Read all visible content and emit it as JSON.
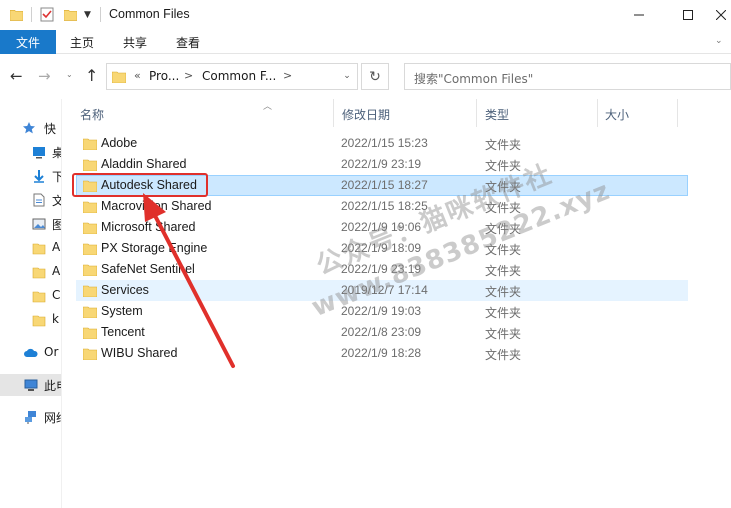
{
  "window": {
    "title": "Common Files"
  },
  "ribbon": {
    "file_tab": "文件",
    "tabs": [
      "主页",
      "共享",
      "查看"
    ]
  },
  "address": {
    "chevrons": "«",
    "crumbs": [
      "Pro...",
      "Common F..."
    ],
    "separator": ">"
  },
  "search": {
    "placeholder": "搜索\"Common Files\""
  },
  "columns": {
    "name": "名称",
    "date": "修改日期",
    "type": "类型",
    "size": "大小"
  },
  "navpane": {
    "items": [
      {
        "label": "快",
        "icon": "star-icon"
      },
      {
        "label": "桌",
        "icon": "desktop-icon"
      },
      {
        "label": "下",
        "icon": "download-icon"
      },
      {
        "label": "文",
        "icon": "document-icon"
      },
      {
        "label": "图",
        "icon": "picture-icon"
      },
      {
        "label": "A",
        "icon": "folder-icon"
      },
      {
        "label": "A",
        "icon": "folder-icon"
      },
      {
        "label": "C",
        "icon": "folder-icon"
      },
      {
        "label": "k",
        "icon": "folder-icon"
      },
      {
        "label": "Or",
        "icon": "cloud-icon"
      },
      {
        "label": "此电",
        "icon": "computer-icon"
      },
      {
        "label": "网络",
        "icon": "network-icon"
      }
    ]
  },
  "files": [
    {
      "name": "Adobe",
      "date": "2022/1/15 15:23",
      "type": "文件夹"
    },
    {
      "name": "Aladdin Shared",
      "date": "2022/1/9 23:19",
      "type": "文件夹"
    },
    {
      "name": "Autodesk Shared",
      "date": "2022/1/15 18:27",
      "type": "文件夹"
    },
    {
      "name": "Macrovision Shared",
      "date": "2022/1/15 18:25",
      "type": "文件夹"
    },
    {
      "name": "Microsoft Shared",
      "date": "2022/1/9 19:06",
      "type": "文件夹"
    },
    {
      "name": "PX Storage Engine",
      "date": "2022/1/9 18:09",
      "type": "文件夹"
    },
    {
      "name": "SafeNet Sentinel",
      "date": "2022/1/9 23:19",
      "type": "文件夹"
    },
    {
      "name": "Services",
      "date": "2019/12/7 17:14",
      "type": "文件夹"
    },
    {
      "name": "System",
      "date": "2022/1/9 19:03",
      "type": "文件夹"
    },
    {
      "name": "Tencent",
      "date": "2022/1/8 23:09",
      "type": "文件夹"
    },
    {
      "name": "WIBU Shared",
      "date": "2022/1/9 18:28",
      "type": "文件夹"
    }
  ],
  "selected_index": 2,
  "hover_index": 7,
  "watermark": {
    "line1": "公众号：猫咪软件社",
    "line2": "www.838385222.xyz"
  },
  "colors": {
    "accent": "#1979ca",
    "selection": "#cce8ff",
    "annotation": "#e0302b",
    "folder": "#f8d775"
  }
}
